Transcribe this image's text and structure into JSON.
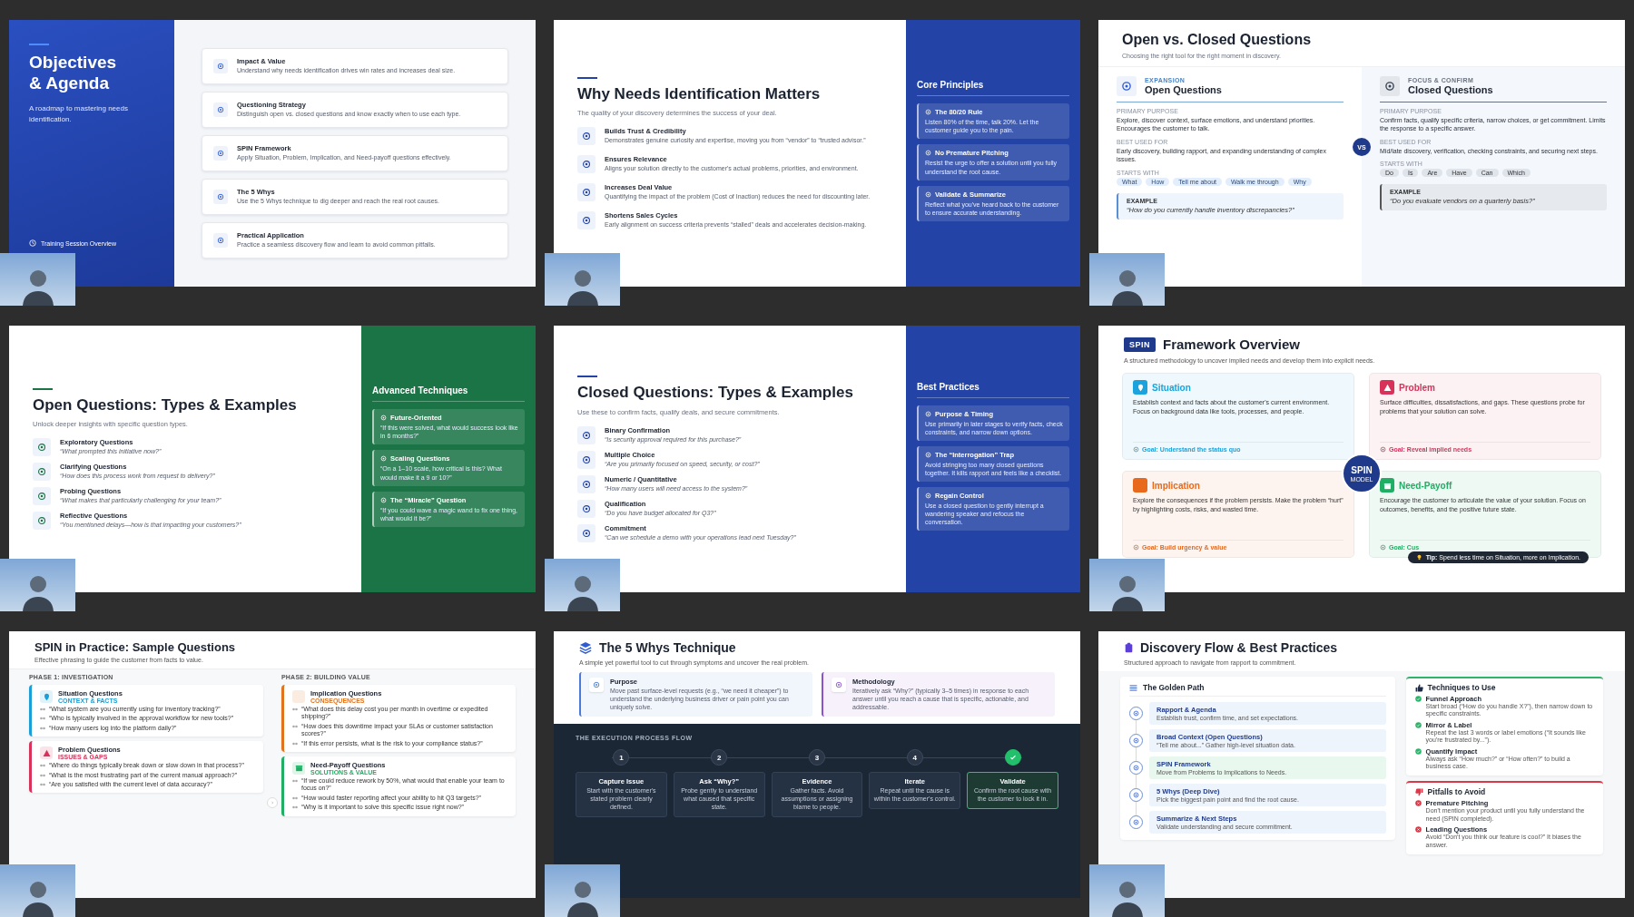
{
  "slides": [
    {
      "kind": "agenda",
      "title": "Objectives & Agenda",
      "subtitle": "A roadmap to mastering needs identification.",
      "footer": "Training Session Overview",
      "items": [
        {
          "title": "Impact & Value",
          "desc": "Understand why needs identification drives win rates and increases deal size."
        },
        {
          "title": "Questioning Strategy",
          "desc": "Distinguish open vs. closed questions and know exactly when to use each type."
        },
        {
          "title": "SPIN Framework",
          "desc": "Apply Situation, Problem, Implication, and Need-payoff questions effectively."
        },
        {
          "title": "The 5 Whys",
          "desc": "Use the 5 Whys technique to dig deeper and reach the real root causes."
        },
        {
          "title": "Practical Application",
          "desc": "Practice a seamless discovery flow and learn to avoid common pitfalls."
        }
      ]
    },
    {
      "kind": "split",
      "color": "#2344a6",
      "title": "Why Needs Identification Matters",
      "subtitle": "The quality of your discovery determines the success of your deal.",
      "items": [
        {
          "title": "Builds Trust & Credibility",
          "desc": "Demonstrates genuine curiosity and expertise, moving you from “vendor” to “trusted advisor.”"
        },
        {
          "title": "Ensures Relevance",
          "desc": "Aligns your solution directly to the customer's actual problems, priorities, and environment."
        },
        {
          "title": "Increases Deal Value",
          "desc": "Quantifying the impact of the problem (Cost of Inaction) reduces the need for discounting later."
        },
        {
          "title": "Shortens Sales Cycles",
          "desc": "Early alignment on success criteria prevents “stalled” deals and accelerates decision-making."
        }
      ],
      "panel": {
        "heading": "Core Principles",
        "cards": [
          {
            "title": "The 80/20 Rule",
            "desc": "Listen 80% of the time, talk 20%. Let the customer guide you to the pain."
          },
          {
            "title": "No Premature Pitching",
            "desc": "Resist the urge to offer a solution until you fully understand the root cause."
          },
          {
            "title": "Validate & Summarize",
            "desc": "Reflect what you've heard back to the customer to ensure accurate understanding."
          }
        ]
      }
    },
    {
      "kind": "compare",
      "title": "Open vs. Closed Questions",
      "subtitle": "Choosing the right tool for the right moment in discovery.",
      "vs": "VS",
      "columns": [
        {
          "tag": "EXPANSION",
          "heading": "Open Questions",
          "purpose_label": "PRIMARY PURPOSE",
          "purpose": "Explore, discover context, surface emotions, and understand priorities. Encourages the customer to talk.",
          "best_label": "BEST USED FOR",
          "best": "Early discovery, building rapport, and expanding understanding of complex issues.",
          "starts_label": "STARTS WITH",
          "chips": [
            "What",
            "How",
            "Tell me about",
            "Walk me through",
            "Why"
          ],
          "example_label": "EXAMPLE",
          "example": "“How do you currently handle inventory discrepancies?”"
        },
        {
          "tag": "FOCUS & CONFIRM",
          "heading": "Closed Questions",
          "purpose_label": "PRIMARY PURPOSE",
          "purpose": "Confirm facts, qualify specific criteria, narrow choices, or get commitment. Limits the response to a specific answer.",
          "best_label": "BEST USED FOR",
          "best": "Mid/late discovery, verification, checking constraints, and securing next steps.",
          "starts_label": "STARTS WITH",
          "chips": [
            "Do",
            "Is",
            "Are",
            "Have",
            "Can",
            "Which"
          ],
          "example_label": "EXAMPLE",
          "example": "“Do you evaluate vendors on a quarterly basis?”"
        }
      ]
    },
    {
      "kind": "split",
      "color": "#1b7445",
      "title": "Open Questions: Types & Examples",
      "subtitle": "Unlock deeper insights with specific question types.",
      "items": [
        {
          "title": "Exploratory Questions",
          "quote": "“What prompted this initiative now?”"
        },
        {
          "title": "Clarifying Questions",
          "quote": "“How does this process work from request to delivery?”"
        },
        {
          "title": "Probing Questions",
          "quote": "“What makes that particularly challenging for your team?”"
        },
        {
          "title": "Reflective Questions",
          "quote": "“You mentioned delays—how is that impacting your customers?”"
        }
      ],
      "panel": {
        "heading": "Advanced Techniques",
        "cards": [
          {
            "title": "Future-Oriented",
            "desc": "“If this were solved, what would success look like in 6 months?”"
          },
          {
            "title": "Scaling Questions",
            "desc": "“On a 1–10 scale, how critical is this? What would make it a 9 or 10?”"
          },
          {
            "title": "The “Miracle” Question",
            "desc": "“If you could wave a magic wand to fix one thing, what would it be?”"
          }
        ]
      }
    },
    {
      "kind": "split",
      "color": "#2344a6",
      "title": "Closed Questions: Types & Examples",
      "subtitle": "Use these to confirm facts, qualify deals, and secure commitments.",
      "items": [
        {
          "title": "Binary Confirmation",
          "quote": "“Is security approval required for this purchase?”"
        },
        {
          "title": "Multiple Choice",
          "quote": "“Are you primarily focused on speed, security, or cost?”"
        },
        {
          "title": "Numeric / Quantitative",
          "quote": "“How many users will need access to the system?”"
        },
        {
          "title": "Qualification",
          "quote": "“Do you have budget allocated for Q3?”"
        },
        {
          "title": "Commitment",
          "quote": "“Can we schedule a demo with your operations lead next Tuesday?”"
        }
      ],
      "panel": {
        "heading": "Best Practices",
        "cards": [
          {
            "title": "Purpose & Timing",
            "desc": "Use primarily in later stages to verify facts, check constraints, and narrow down options."
          },
          {
            "title": "The “Interrogation” Trap",
            "desc": "Avoid stringing too many closed questions together. It kills rapport and feels like a checklist."
          },
          {
            "title": "Regain Control",
            "desc": "Use a closed question to gently interrupt a wandering speaker and refocus the conversation."
          }
        ]
      }
    },
    {
      "kind": "spin",
      "badge": "SPIN",
      "title": "Framework Overview",
      "subtitle": "A structured methodology to uncover implied needs and develop them into explicit needs.",
      "cards": [
        {
          "title": "Situation",
          "color": "#1aa3dc",
          "desc": "Establish context and facts about the customer's current environment. Focus on background data like tools, processes, and people.",
          "goal": "Goal: Understand the status quo"
        },
        {
          "title": "Problem",
          "color": "#d8325a",
          "desc": "Surface difficulties, dissatisfactions, and gaps. These questions probe for problems that your solution can solve.",
          "goal": "Goal: Reveal implied needs"
        },
        {
          "title": "Implication",
          "color": "#e8681c",
          "desc": "Explore the consequences if the problem persists. Make the problem “hurt” by highlighting costs, risks, and wasted time.",
          "goal": "Goal: Build urgency & value"
        },
        {
          "title": "Need-Payoff",
          "color": "#1fae63",
          "desc": "Encourage the customer to articulate the value of your solution. Focus on outcomes, benefits, and the positive future state.",
          "goal": "Goal: Cus"
        }
      ],
      "center": {
        "title": "SPIN",
        "caption": "MODEL"
      },
      "tip": "**Tip:** Spend less time on Situation, more on Implication."
    },
    {
      "kind": "practice",
      "title": "SPIN in Practice: Sample Questions",
      "subtitle": "Effective phrasing to guide the customer from facts to value.",
      "phases": [
        {
          "label": "PHASE 1: INVESTIGATION",
          "cards": [
            {
              "title": "Situation Questions",
              "tag": "CONTEXT & FACTS",
              "color": "#1a9fd6",
              "questions": [
                "“What system are you currently using for inventory tracking?”",
                "“Who is typically involved in the approval workflow for new tools?”",
                "“How many users log into the platform daily?”"
              ]
            },
            {
              "title": "Problem Questions",
              "tag": "ISSUES & GAPS",
              "color": "#d8325a",
              "questions": [
                "“Where do things typically break down or slow down in that process?”",
                "“What is the most frustrating part of the current manual approach?”",
                "“Are you satisfied with the current level of data accuracy?”"
              ]
            }
          ]
        },
        {
          "label": "PHASE 2: BUILDING VALUE",
          "cards": [
            {
              "title": "Implication Questions",
              "tag": "CONSEQUENCES",
              "color": "#e0741e",
              "questions": [
                "“What does this delay cost you per month in overtime or expedited shipping?”",
                "“How does this downtime impact your SLAs or customer satisfaction scores?”",
                "“If this error persists, what is the risk to your compliance status?”"
              ]
            },
            {
              "title": "Need-Payoff Questions",
              "tag": "SOLUTIONS & VALUE",
              "color": "#1fae63",
              "questions": [
                "“If we could reduce rework by 50%, what would that enable your team to focus on?”",
                "“How would faster reporting affect your ability to hit Q3 targets?”",
                "“Why is it important to solve this specific issue right now?”"
              ]
            }
          ]
        }
      ]
    },
    {
      "kind": "whys",
      "title": "The 5 Whys Technique",
      "subtitle": "A simple yet powerful tool to cut through symptoms and uncover the real problem.",
      "cards": [
        {
          "title": "Purpose",
          "color": "#4a7bd8",
          "desc": "Move past surface-level requests (e.g., “we need it cheaper”) to understand the underlying business driver or pain point you can uniquely solve."
        },
        {
          "title": "Methodology",
          "color": "#8b52d0",
          "desc": "Iteratively ask “Why?” (typically 3–5 times) in response to each answer until you reach a cause that is specific, actionable, and addressable."
        }
      ],
      "flow_label": "THE EXECUTION PROCESS FLOW",
      "steps": [
        {
          "kind": "number",
          "number": "1",
          "title": "Capture Issue",
          "desc": "Start with the customer's stated problem clearly defined.",
          "highlighted": false
        },
        {
          "kind": "number",
          "number": "2",
          "title": "Ask “Why?”",
          "desc": "Probe gently to understand what caused that specific state.",
          "highlighted": false
        },
        {
          "kind": "number",
          "number": "3",
          "title": "Evidence",
          "desc": "Gather facts. Avoid assumptions or assigning blame to people.",
          "highlighted": false
        },
        {
          "kind": "number",
          "number": "4",
          "title": "Iterate",
          "desc": "Repeat until the cause is within the customer's control.",
          "highlighted": false
        },
        {
          "kind": "check",
          "title": "Validate",
          "desc": "Confirm the root cause with the customer to lock it in.",
          "highlighted": true
        }
      ]
    },
    {
      "kind": "flow",
      "title": "Discovery Flow & Best Practices",
      "subtitle": "Structured approach to navigate from rapport to commitment.",
      "path": {
        "heading": "The Golden Path",
        "steps": [
          {
            "title": "Rapport & Agenda",
            "desc": "Establish trust, confirm time, and set expectations.",
            "highlighted": false
          },
          {
            "title": "Broad Context (Open Questions)",
            "desc": "“Tell me about...” Gather high-level situation data.",
            "highlighted": false
          },
          {
            "title": "SPIN Framework",
            "desc": "Move from Problems to Implications to Needs.",
            "highlighted": true
          },
          {
            "title": "5 Whys (Deep Dive)",
            "desc": "Pick the biggest pain point and find the root cause.",
            "highlighted": false
          },
          {
            "title": "Summarize & Next Steps",
            "desc": "Validate understanding and secure commitment.",
            "highlighted": false
          }
        ]
      },
      "boxes": [
        {
          "kind": "good",
          "heading": "Techniques to Use",
          "items": [
            {
              "title": "Funnel Approach",
              "desc": "Start broad (“How do you handle X?”), then narrow down to specific constraints."
            },
            {
              "title": "Mirror & Label",
              "desc": "Repeat the last 3 words or label emotions (“It sounds like you're frustrated by...”)."
            },
            {
              "title": "Quantify Impact",
              "desc": "Always ask “How much?” or “How often?” to build a business case."
            }
          ]
        },
        {
          "kind": "bad",
          "heading": "Pitfalls to Avoid",
          "items": [
            {
              "title": "Premature Pitching",
              "desc": "Don't mention your product until you fully understand the need (SPIN completed)."
            },
            {
              "title": "Leading Questions",
              "desc": "Avoid “Don't you think our feature is cool?” It biases the answer."
            }
          ]
        }
      ]
    }
  ]
}
